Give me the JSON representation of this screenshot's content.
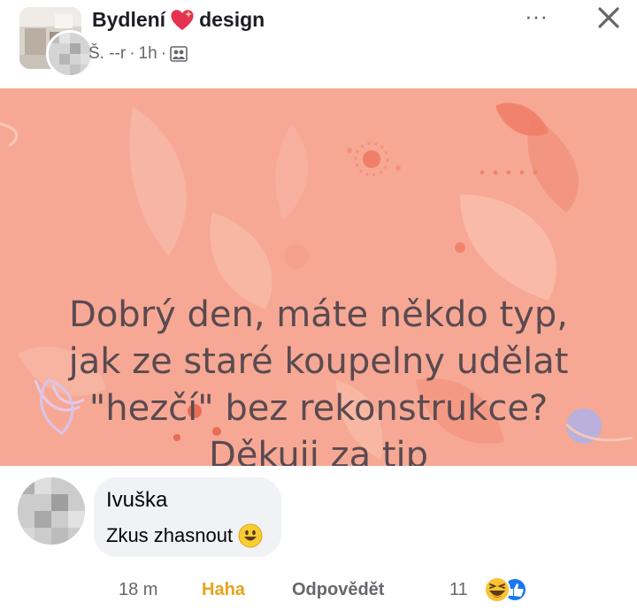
{
  "post": {
    "group_name_part1": "Bydlení",
    "group_name_part2": "design",
    "author_redacted": "Š. ‐‐r",
    "time": "1h",
    "image_text": {
      "line1": "Dobrý den, máte někdo typ,",
      "line2": "jak ze staré koupelny udělat",
      "line3": "\"hezčí\" bez rekonstrukce?",
      "line4": "Děkuji za tip"
    }
  },
  "icons": {
    "more": "more-options-icon",
    "close": "close-icon",
    "heart": "heart-sparkle-icon",
    "group": "group-members-icon",
    "smile": "smiley-emoji-icon",
    "reactions": [
      "haha-reaction-icon",
      "like-reaction-icon"
    ]
  },
  "header": {
    "more_label": "···"
  },
  "comment": {
    "author": "Ivuška",
    "text": "Zkus zhasnout",
    "time": "18 m",
    "haha_label": "Haha",
    "reply_label": "Odpovědět",
    "reaction_count": "11"
  },
  "colors": {
    "image_background": "#f6a894",
    "image_text": "#5a4a50",
    "haha": "#e8a21c",
    "like": "#1877f2",
    "bubble": "#f0f2f5"
  }
}
